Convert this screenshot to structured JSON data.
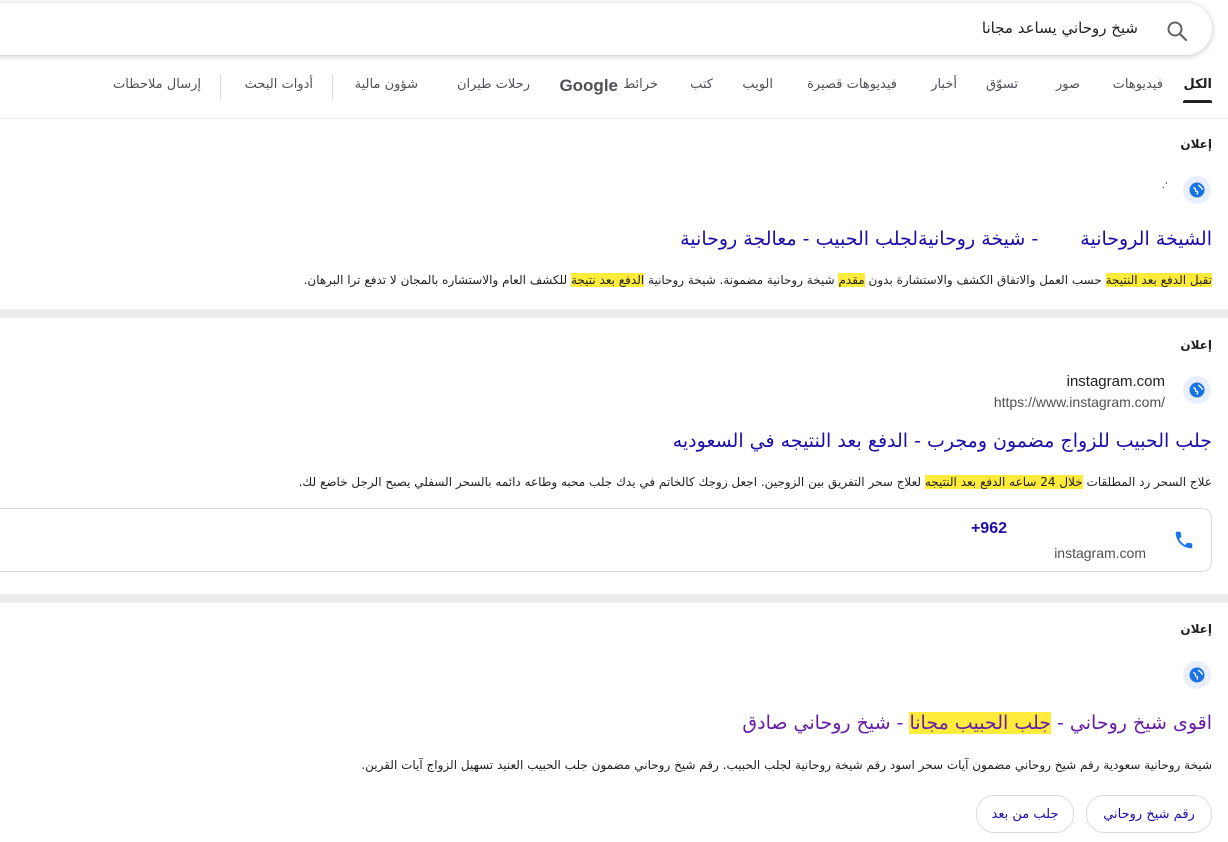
{
  "search": {
    "query": "شيخ روحاني يساعد مجانا"
  },
  "tabs": [
    {
      "label": "الكل",
      "active": true
    },
    {
      "label": "فيديوهات"
    },
    {
      "label": "صور"
    },
    {
      "label": "تسوّق"
    },
    {
      "label": "أخبار"
    },
    {
      "label": "فيديوهات قصيرة"
    },
    {
      "label": "الويب"
    },
    {
      "label": "كتب"
    },
    {
      "label": "خرائط"
    },
    {
      "label": "Google"
    },
    {
      "label": "رحلات طيران"
    },
    {
      "label": "شؤون مالية"
    },
    {
      "label": "أدوات البحث"
    },
    {
      "label": "إرسال ملاحظات"
    }
  ],
  "ads": [
    {
      "label": "إعلان",
      "title_parts": [
        "الشيخة الروحانية",
        " - شيخة روحانيةلجلب الحبيب - معالجة روحانية"
      ],
      "desc_segments": [
        {
          "t": "تقبل الدفع بعد النتيجة",
          "hl": true
        },
        {
          "t": " حسب العمل والاتفاق الكشف والاستشارة بدون ",
          "hl": false
        },
        {
          "t": "مقدم",
          "hl": true
        },
        {
          "t": " شيخة روحانية مضمونة. شيخة روحانية ",
          "hl": false
        },
        {
          "t": "الدفع بعد نتيجة",
          "hl": true
        },
        {
          "t": " للكشف العام والاستشاره بالمجان لا تدفع ترا البرهان.",
          "hl": false
        }
      ]
    },
    {
      "label": "إعلان",
      "site_name": "instagram.com",
      "site_url": "https://www.instagram.com/",
      "title": "جلب الحبيب للزواج مضمون ومجرب - الدفع بعد النتيجه في السعوديه",
      "desc_segments": [
        {
          "t": "علاج السحر رد المطلقات ",
          "hl": false
        },
        {
          "t": "خلال 24 ساعه الدفع بعد النتيجه",
          "hl": true
        },
        {
          "t": " لعلاج سحر التفريق بين الزوجين. اجعل زوجك كالخاتم في يدك جلب محبه وطاعه دائمه بالسحر السفلي يصبح الرجل خاضع لك.",
          "hl": false
        }
      ],
      "call": {
        "number": "+962",
        "site": "instagram.com"
      }
    },
    {
      "label": "إعلان",
      "title_segments": [
        {
          "t": "اقوى شيخ روحاني - ",
          "hl": false
        },
        {
          "t": "جلب الحبيب مجانا",
          "hl": true
        },
        {
          "t": " - شيخ روحاني صادق",
          "hl": false
        }
      ],
      "desc": "شيخة روحانية سعودية رقم شيخ روحاني مضمون آيات سحر اسود رقم شيخة روحانية لجلب الحبيب. رقم شيخ روحاني مضمون جلب الحبيب العنيد تسهيل الزواج آيات القرين.",
      "chips": [
        "رقم شيخ روحاني",
        "جلب من بعد"
      ]
    }
  ]
}
